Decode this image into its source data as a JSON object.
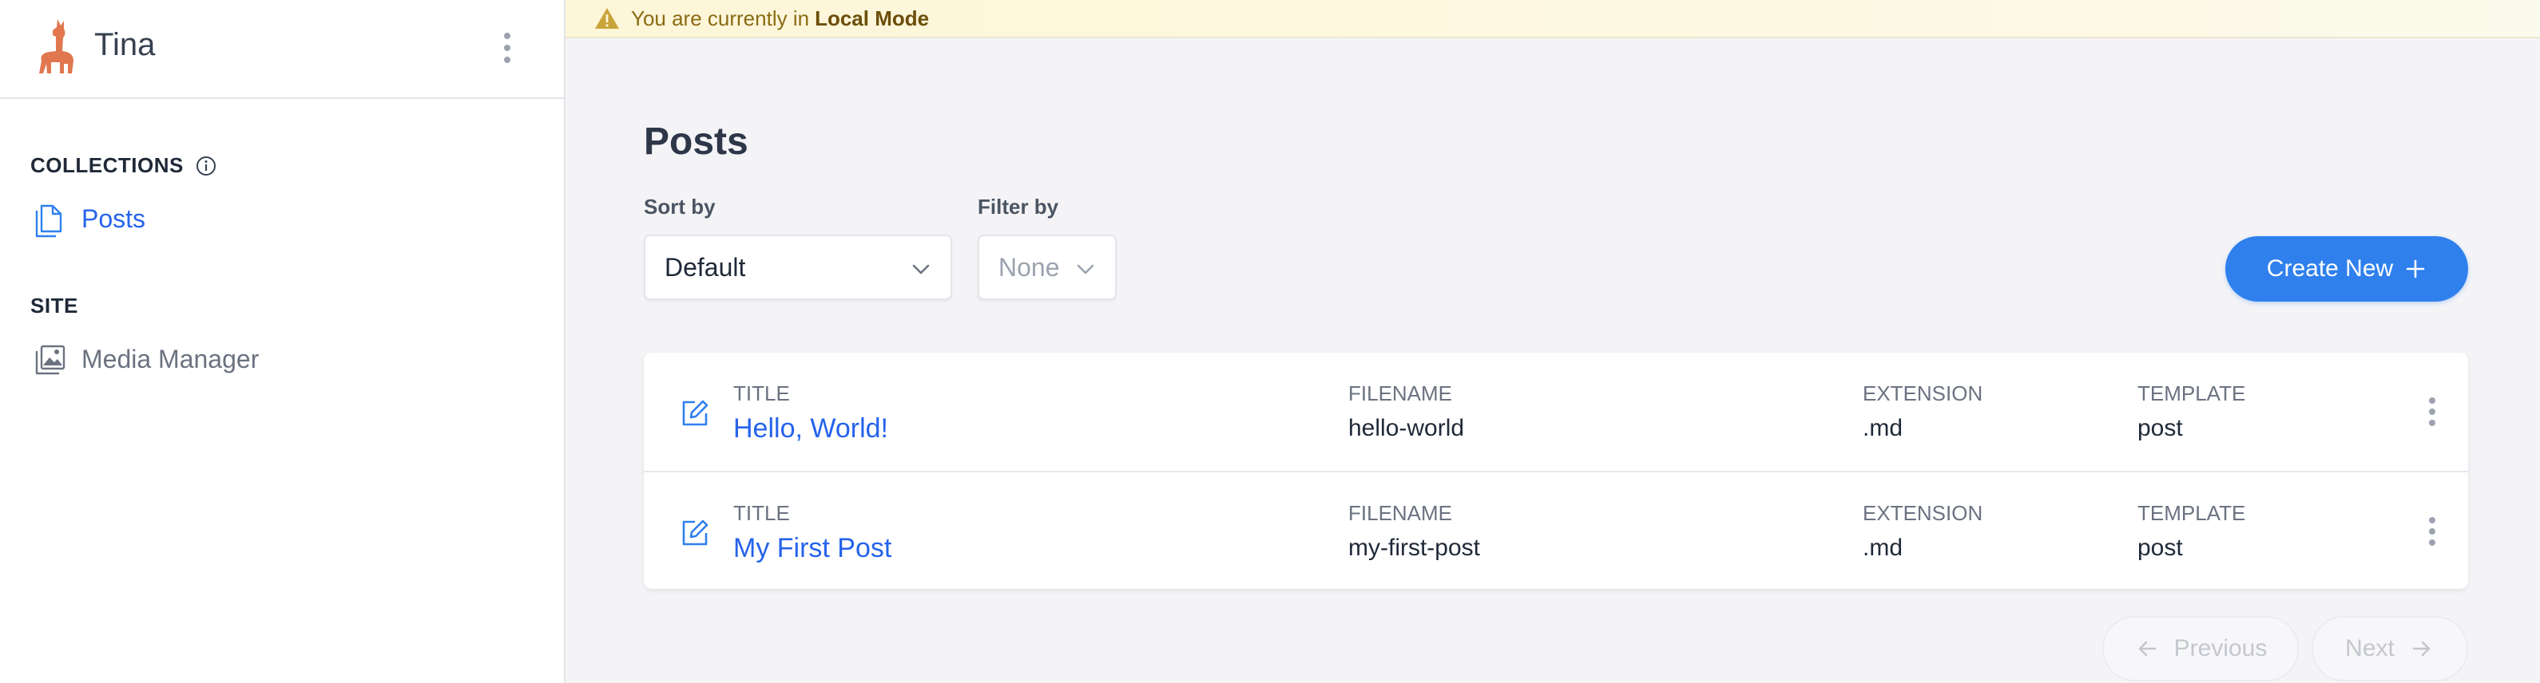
{
  "app": {
    "name": "Tina"
  },
  "banner": {
    "prefix": "You are currently in",
    "mode": "Local Mode"
  },
  "sidebar": {
    "collections_label": "COLLECTIONS",
    "collections": [
      {
        "label": "Posts",
        "icon": "documents-icon"
      }
    ],
    "site_label": "SITE",
    "site_items": [
      {
        "label": "Media Manager",
        "icon": "media-icon"
      }
    ]
  },
  "main": {
    "title": "Posts",
    "sort": {
      "label": "Sort by",
      "value": "Default"
    },
    "filter": {
      "label": "Filter by",
      "value": "None"
    },
    "create_button": "Create New",
    "columns": {
      "title": "TITLE",
      "filename": "FILENAME",
      "extension": "EXTENSION",
      "template": "TEMPLATE"
    },
    "rows": [
      {
        "title": "Hello, World!",
        "filename": "hello-world",
        "extension": ".md",
        "template": "post"
      },
      {
        "title": "My First Post",
        "filename": "my-first-post",
        "extension": ".md",
        "template": "post"
      }
    ],
    "pagination": {
      "previous": "Previous",
      "next": "Next"
    }
  },
  "colors": {
    "accent": "#2f80ed",
    "link": "#2563eb",
    "logo": "#e0774f",
    "banner_bg": "#fdf6d8",
    "banner_text": "#8a6a13"
  }
}
